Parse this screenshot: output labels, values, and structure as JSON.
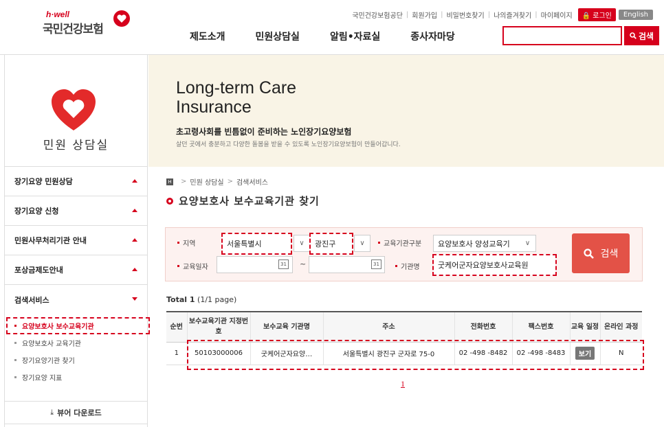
{
  "header": {
    "logo_hwell": "h·well",
    "logo_name": "국민건강보험",
    "top_links": [
      "국민건강보험공단",
      "회원가입",
      "비밀번호찾기",
      "나의즐겨찾기",
      "마이페이지"
    ],
    "login_label": "로그인",
    "english_label": "English",
    "gnb": [
      "제도소개",
      "민원상담실",
      "알림•자료실",
      "종사자마당"
    ],
    "search_button": "검색"
  },
  "sidebar": {
    "title": "민원 상담실",
    "menu": [
      {
        "label": "장기요양 민원상담"
      },
      {
        "label": "장기요양 신청"
      },
      {
        "label": "민원사무처리기관 안내"
      },
      {
        "label": "포상금제도안내"
      },
      {
        "label": "검색서비스"
      }
    ],
    "sub_items": [
      {
        "label": "요양보호사 보수교육기관"
      },
      {
        "label": "요양보호사 교육기관"
      },
      {
        "label": "장기요양기관 찾기"
      },
      {
        "label": "장기요양 지표"
      }
    ],
    "viewer_download": "뷰어 다운로드"
  },
  "banner": {
    "title_line1": "Long-term Care",
    "title_line2": "Insurance",
    "subtitle": "초고령사회를 빈틈없이 준비하는 노인장기요양보험",
    "description": "살던 곳에서 충분하고 다양한 돌봄을 받을 수 있도록 노인장기요양보험이 만들어갑니다."
  },
  "breadcrumb": [
    "민원 상담실",
    "검색서비스"
  ],
  "page_title": "요양보호사 보수교육기관 찾기",
  "search_form": {
    "region_label": "지역",
    "region_value": "서울특별시",
    "district_value": "광진구",
    "category_label": "교육기관구분",
    "category_value": "요양보호사 양성교육기",
    "date_label": "교육일자",
    "date_sep": "~",
    "org_label": "기관명",
    "org_value": "굿케어군자요양보호사교육원",
    "search_button": "검색"
  },
  "results": {
    "total_count": "1",
    "page_info": "(1/1 page)",
    "columns": [
      "순번",
      "보수교육기관 지정번호",
      "보수교육 기관명",
      "주소",
      "전화번호",
      "팩스번호",
      "교육 일정",
      "온라인 과정"
    ],
    "rows": [
      [
        "1",
        "50103000006",
        "굿케어군자요양…",
        "서울특별시 광진구 군자로 75-0",
        "02 -498 -8482",
        "02 -498 -8483",
        "보기",
        "N"
      ]
    ],
    "page": "1"
  }
}
